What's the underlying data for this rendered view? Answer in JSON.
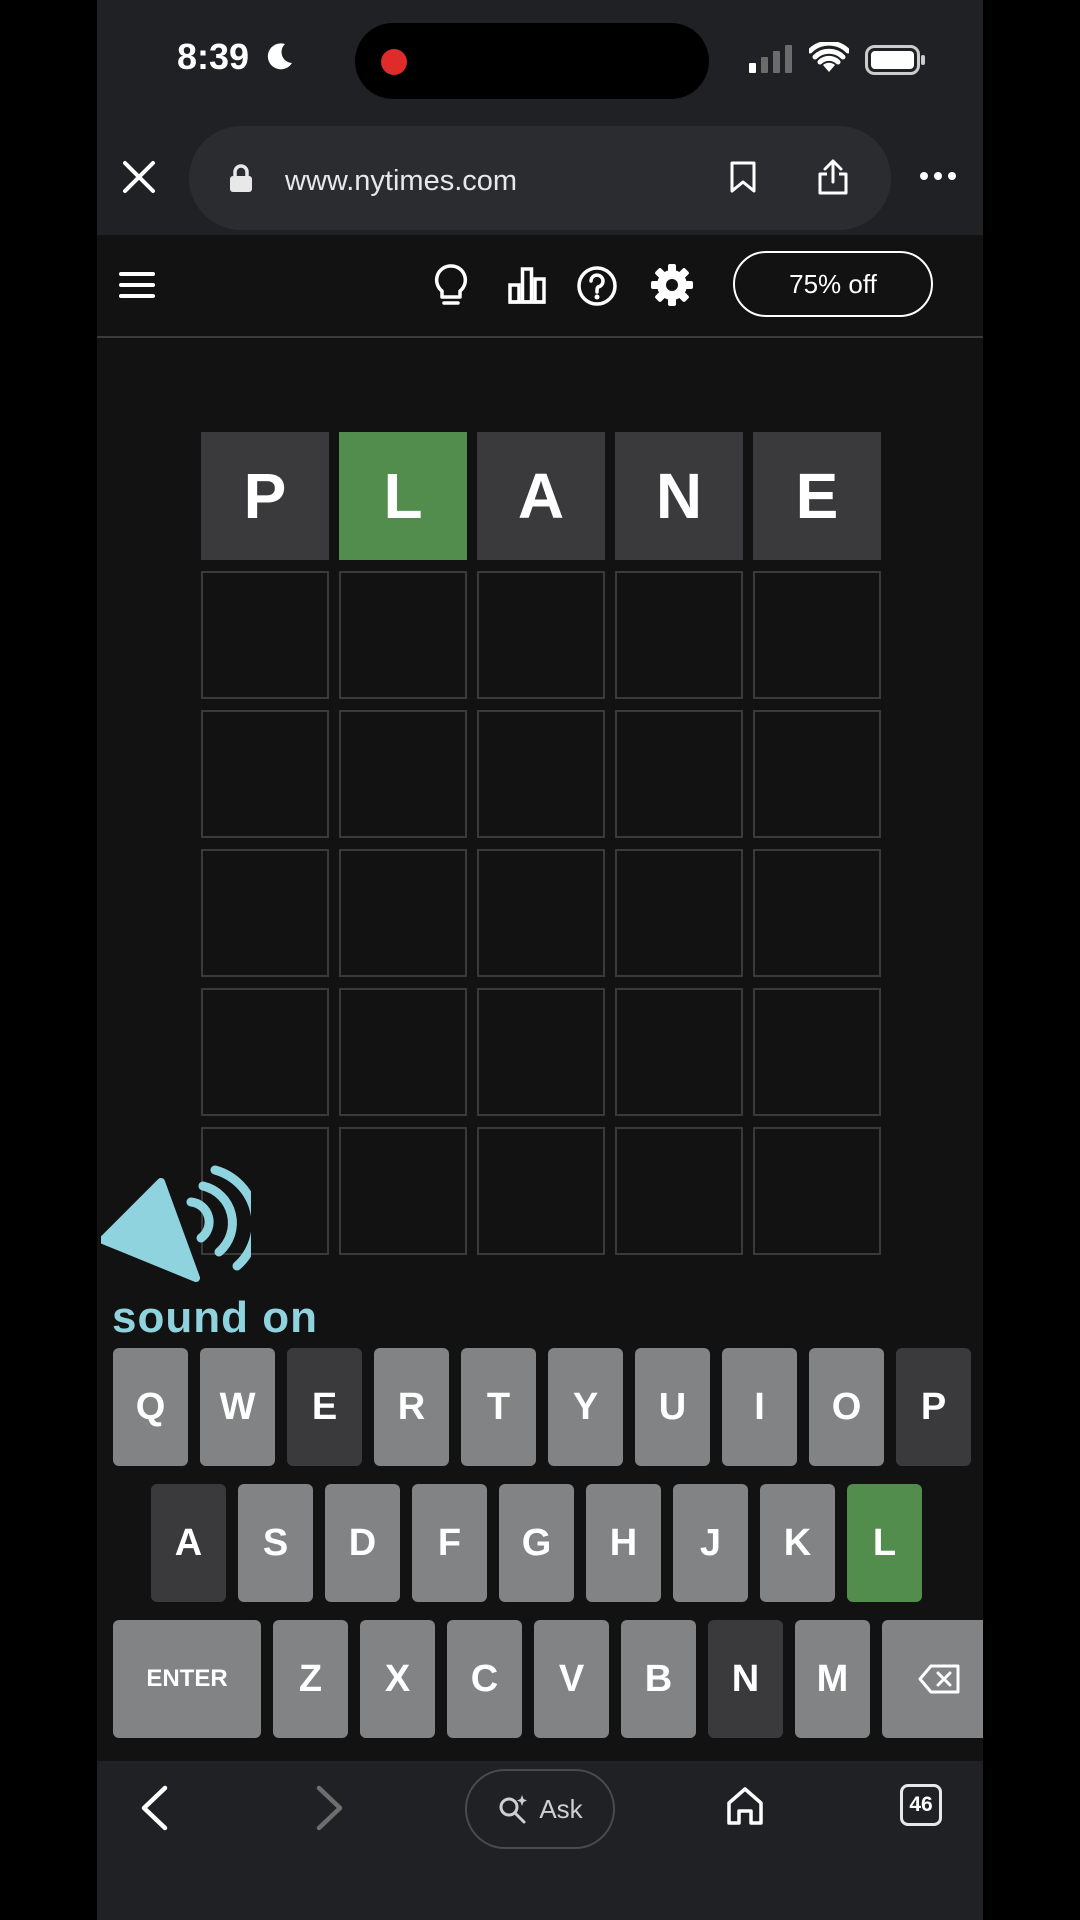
{
  "status_bar": {
    "time": "8:39"
  },
  "browser": {
    "url": "www.nytimes.com",
    "tab_count": "46",
    "ask_label": "Ask"
  },
  "game_header": {
    "offer_label": "75% off"
  },
  "board": {
    "rows": [
      [
        {
          "letter": "P",
          "state": "absent"
        },
        {
          "letter": "L",
          "state": "correct"
        },
        {
          "letter": "A",
          "state": "absent"
        },
        {
          "letter": "N",
          "state": "absent"
        },
        {
          "letter": "E",
          "state": "absent"
        }
      ],
      [
        {
          "letter": "",
          "state": "empty"
        },
        {
          "letter": "",
          "state": "empty"
        },
        {
          "letter": "",
          "state": "empty"
        },
        {
          "letter": "",
          "state": "empty"
        },
        {
          "letter": "",
          "state": "empty"
        }
      ],
      [
        {
          "letter": "",
          "state": "empty"
        },
        {
          "letter": "",
          "state": "empty"
        },
        {
          "letter": "",
          "state": "empty"
        },
        {
          "letter": "",
          "state": "empty"
        },
        {
          "letter": "",
          "state": "empty"
        }
      ],
      [
        {
          "letter": "",
          "state": "empty"
        },
        {
          "letter": "",
          "state": "empty"
        },
        {
          "letter": "",
          "state": "empty"
        },
        {
          "letter": "",
          "state": "empty"
        },
        {
          "letter": "",
          "state": "empty"
        }
      ],
      [
        {
          "letter": "",
          "state": "empty"
        },
        {
          "letter": "",
          "state": "empty"
        },
        {
          "letter": "",
          "state": "empty"
        },
        {
          "letter": "",
          "state": "empty"
        },
        {
          "letter": "",
          "state": "empty"
        }
      ],
      [
        {
          "letter": "",
          "state": "empty"
        },
        {
          "letter": "",
          "state": "empty"
        },
        {
          "letter": "",
          "state": "empty"
        },
        {
          "letter": "",
          "state": "empty"
        },
        {
          "letter": "",
          "state": "empty"
        }
      ]
    ]
  },
  "overlay": {
    "sound_text": "sound on"
  },
  "keyboard": {
    "row1": [
      {
        "k": "Q",
        "s": ""
      },
      {
        "k": "W",
        "s": ""
      },
      {
        "k": "E",
        "s": "absent"
      },
      {
        "k": "R",
        "s": ""
      },
      {
        "k": "T",
        "s": ""
      },
      {
        "k": "Y",
        "s": ""
      },
      {
        "k": "U",
        "s": ""
      },
      {
        "k": "I",
        "s": ""
      },
      {
        "k": "O",
        "s": ""
      },
      {
        "k": "P",
        "s": "absent"
      }
    ],
    "row2": [
      {
        "k": "A",
        "s": "absent"
      },
      {
        "k": "S",
        "s": ""
      },
      {
        "k": "D",
        "s": ""
      },
      {
        "k": "F",
        "s": ""
      },
      {
        "k": "G",
        "s": ""
      },
      {
        "k": "H",
        "s": ""
      },
      {
        "k": "J",
        "s": ""
      },
      {
        "k": "K",
        "s": ""
      },
      {
        "k": "L",
        "s": "correct"
      }
    ],
    "row3": [
      {
        "k": "Z",
        "s": ""
      },
      {
        "k": "X",
        "s": ""
      },
      {
        "k": "C",
        "s": ""
      },
      {
        "k": "V",
        "s": ""
      },
      {
        "k": "B",
        "s": ""
      },
      {
        "k": "N",
        "s": "absent"
      },
      {
        "k": "M",
        "s": ""
      }
    ],
    "enter_label": "ENTER"
  },
  "colors": {
    "correct": "#538d4e",
    "absent": "#3a3a3c",
    "key_default": "#818384",
    "sound_accent": "#8fd3df"
  }
}
